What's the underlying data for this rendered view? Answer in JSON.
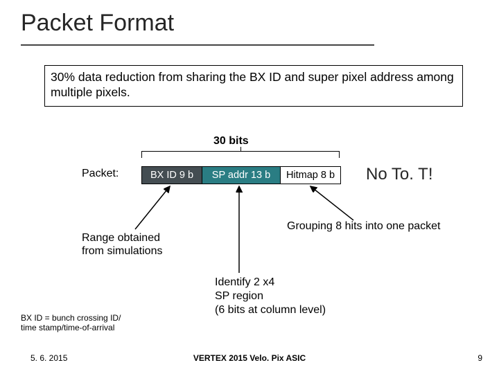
{
  "title": "Packet Format",
  "note": "30% data reduction from sharing the BX ID and super pixel address among multiple pixels.",
  "bits_label": "30 bits",
  "packet_label": "Packet:",
  "segments": {
    "bx": "BX ID 9 b",
    "sp": "SP addr 13 b",
    "hm": "Hitmap 8 b"
  },
  "no_tot": "No To. T!",
  "ann_left_l1": "Range obtained",
  "ann_left_l2": "from simulations",
  "ann_right": "Grouping 8 hits into one packet",
  "ann_mid_l1": "Identify 2 x4",
  "ann_mid_l2": "SP region",
  "ann_mid_l3": "(6 bits at column level)",
  "small_note_l1": "BX ID = bunch crossing ID/",
  "small_note_l2": "time stamp/time-of-arrival",
  "footer": {
    "date": "5. 6. 2015",
    "center": "VERTEX 2015 Velo. Pix ASIC",
    "page": "9"
  }
}
